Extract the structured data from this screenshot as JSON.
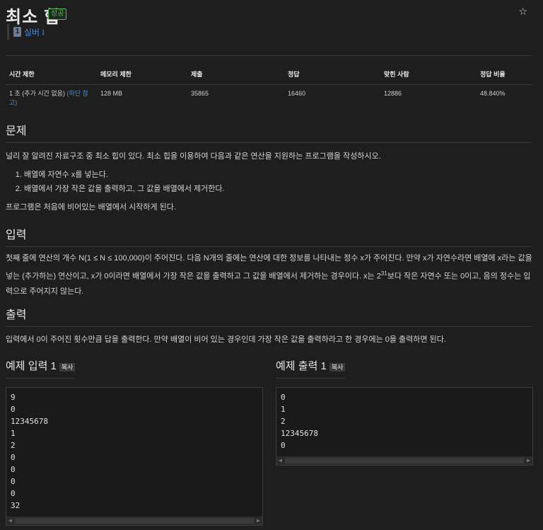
{
  "header": {
    "title": "최소 힙",
    "badge": "성공",
    "star": "☆"
  },
  "tier": {
    "icon": "1",
    "label": "실버 I"
  },
  "info_table": {
    "headers": [
      "시간 제한",
      "메모리 제한",
      "제출",
      "정답",
      "맞힌 사람",
      "정답 비율"
    ],
    "time_limit": "1 초 (추가 시간 없음) ",
    "time_note": "(하단 참고)",
    "memory": "128 MB",
    "submissions": "35865",
    "accepted": "16460",
    "solvers": "12886",
    "ratio": "48.840%"
  },
  "problem": {
    "heading": "문제",
    "intro": "널리 잘 알려진 자료구조 중 최소 힙이 있다. 최소 힙을 이용하여 다음과 같은 연산을 지원하는 프로그램을 작성하시오.",
    "ops": [
      "배열에 자연수 x를 넣는다.",
      "배열에서 가장 작은 값을 출력하고, 그 값을 배열에서 제거한다."
    ],
    "outro": "프로그램은 처음에 비어있는 배열에서 시작하게 된다."
  },
  "input": {
    "heading": "입력",
    "text_a": "첫째 줄에 연산의 개수 N(1 ≤ N ≤ 100,000)이 주어진다. 다음 N개의 줄에는 연산에 대한 정보를 나타내는 정수 x가 주어진다. 만약 x가 자연수라면 배열에 x라는 값을 넣는 (추가하는) 연산이고, x가 0이라면 배열에서 가장 작은 값을 출력하고 그 값을 배열에서 제거하는 경우이다. x는 2",
    "text_sup": "31",
    "text_b": "보다 작은 자연수 또는 0이고, 음의 정수는 입력으로 주어지지 않는다."
  },
  "output": {
    "heading": "출력",
    "text": "입력에서 0이 주어진 횟수만큼 답을 출력한다. 만약 배열이 비어 있는 경우인데 가장 작은 값을 출력하라고 한 경우에는 0을 출력하면 된다."
  },
  "sample_input": {
    "heading": "예제 입력 1",
    "copy": "복사",
    "lines": [
      "9",
      "0",
      "12345678",
      "1",
      "2",
      "0",
      "0",
      "0",
      "0",
      "32"
    ]
  },
  "sample_output": {
    "heading": "예제 출력 1",
    "copy": "복사",
    "lines": [
      "0",
      "1",
      "2",
      "12345678",
      "0"
    ]
  }
}
